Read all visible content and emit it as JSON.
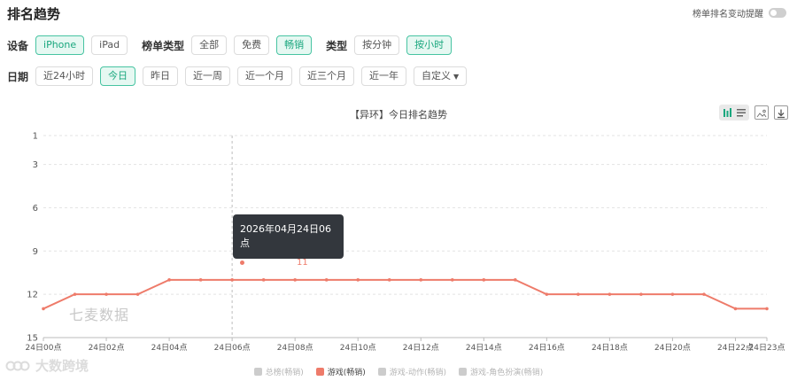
{
  "header": {
    "title": "排名趋势",
    "alert_label": "榜单排名变动提醒"
  },
  "filters": {
    "device_label": "设备",
    "devices": [
      "iPhone",
      "iPad"
    ],
    "chart_type_label": "榜单类型",
    "chart_types": [
      "全部",
      "免费",
      "畅销"
    ],
    "type_label": "类型",
    "granularity": [
      "按分钟",
      "按小时"
    ],
    "date_label": "日期",
    "dates": [
      "近24小时",
      "今日",
      "昨日",
      "近一周",
      "近一个月",
      "近三个月",
      "近一年"
    ],
    "custom_label": "自定义"
  },
  "colors": {
    "accent": "#1aa77e",
    "series": "#ee7b6a",
    "inactive": "#cccccc"
  },
  "watermark": "七麦数据",
  "logo_text": "大数跨境",
  "tooltip": {
    "title": "2026年04月24日06点",
    "series_name": "游戏(畅销)",
    "value": "11"
  },
  "chart_data": {
    "type": "line",
    "title": "【异环】今日排名趋势",
    "x": [
      "24日00点",
      "24日01点",
      "24日02点",
      "24日03点",
      "24日04点",
      "24日05点",
      "24日06点",
      "24日07点",
      "24日08点",
      "24日09点",
      "24日10点",
      "24日11点",
      "24日12点",
      "24日13点",
      "24日14点",
      "24日15点",
      "24日16点",
      "24日17点",
      "24日18点",
      "24日19点",
      "24日20点",
      "24日21点",
      "24日22点",
      "24日23点"
    ],
    "x_tick_labels": [
      "24日00点",
      "24日02点",
      "24日04点",
      "24日06点",
      "24日08点",
      "24日10点",
      "24日12点",
      "24日14点",
      "24日16点",
      "24日18点",
      "24日20点",
      "24日22点",
      "24日23点"
    ],
    "y_ticks": [
      1,
      3,
      6,
      9,
      12,
      15
    ],
    "ylim": [
      1,
      15
    ],
    "y_inverted": true,
    "grid": true,
    "legend_position": "bottom",
    "legend": [
      "总榜(畅销)",
      "游戏(畅销)",
      "游戏-动作(畅销)",
      "游戏-角色扮演(畅销)"
    ],
    "active_legend": "游戏(畅销)",
    "series": [
      {
        "name": "游戏(畅销)",
        "values": [
          13,
          12,
          12,
          12,
          11,
          11,
          11,
          11,
          11,
          11,
          11,
          11,
          11,
          11,
          11,
          11,
          12,
          12,
          12,
          12,
          12,
          12,
          13,
          13
        ]
      }
    ],
    "highlight_x": "24日06点"
  }
}
